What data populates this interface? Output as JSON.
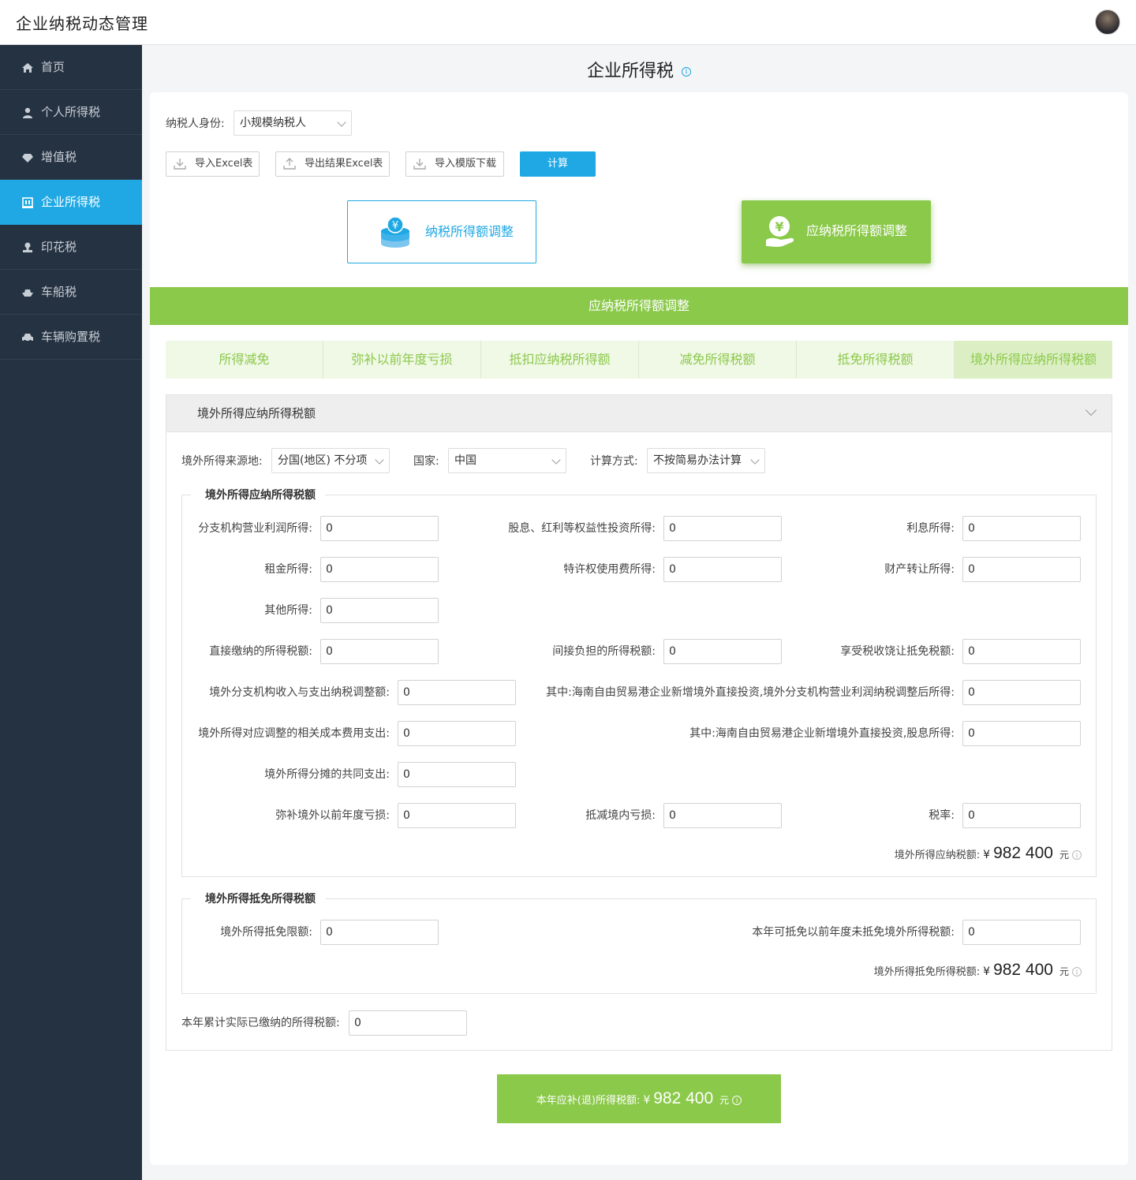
{
  "app": {
    "title": "企业纳税动态管理"
  },
  "sidebar": {
    "items": [
      {
        "label": "首页",
        "icon": "home-icon"
      },
      {
        "label": "个人所得税",
        "icon": "user-icon"
      },
      {
        "label": "增值税",
        "icon": "diamond-icon"
      },
      {
        "label": "企业所得税",
        "icon": "building-icon"
      },
      {
        "label": "印花税",
        "icon": "stamp-icon"
      },
      {
        "label": "车船税",
        "icon": "boat-icon"
      },
      {
        "label": "车辆购置税",
        "icon": "car-icon"
      }
    ],
    "active": "企业所得税"
  },
  "page": {
    "title": "企业所得税",
    "info_icon": "i"
  },
  "taxpayer": {
    "label": "纳税人身份:",
    "value": "小规模纳税人"
  },
  "toolbar": {
    "import_excel": "导入Excel表",
    "export_excel": "导出结果Excel表",
    "template_download": "导入模版下载",
    "calculate": "计算"
  },
  "modes": {
    "taxable_income_adjust": "纳税所得额调整",
    "payable_income_adjust": "应纳税所得额调整"
  },
  "section_bar": "应纳税所得额调整",
  "tabs": [
    "所得减免",
    "弥补以前年度亏损",
    "抵扣应纳税所得额",
    "减免所得税额",
    "抵免所得税额",
    "境外所得应纳所得税额"
  ],
  "panel": {
    "title": "境外所得应纳所得税额",
    "source_label": "境外所得来源地:",
    "source_value": "分国(地区) 不分项",
    "country_label": "国家:",
    "country_value": "中国",
    "method_label": "计算方式:",
    "method_value": "不按简易办法计算"
  },
  "group1": {
    "legend": "境外所得应纳所得税额",
    "fields": [
      {
        "label": "分支机构营业利润所得:",
        "value": "0"
      },
      {
        "label": "股息、红利等权益性投资所得:",
        "value": "0"
      },
      {
        "label": "利息所得:",
        "value": "0"
      },
      {
        "label": "租金所得:",
        "value": "0"
      },
      {
        "label": "特许权使用费所得:",
        "value": "0"
      },
      {
        "label": "财产转让所得:",
        "value": "0"
      },
      {
        "label": "其他所得:",
        "value": "0"
      },
      {
        "label": "直接缴纳的所得税额:",
        "value": "0"
      },
      {
        "label": "间接负担的所得税额:",
        "value": "0"
      },
      {
        "label": "享受税收饶让抵免税额:",
        "value": "0"
      },
      {
        "label": "境外分支机构收入与支出纳税调整额:",
        "value": "0"
      },
      {
        "label": "其中:海南自由贸易港企业新增境外直接投资,境外分支机构营业利润纳税调整后所得:",
        "value": "0"
      },
      {
        "label": "境外所得对应调整的相关成本费用支出:",
        "value": "0"
      },
      {
        "label": "其中:海南自由贸易港企业新增境外直接投资,股息所得:",
        "value": "0"
      },
      {
        "label": "境外所得分摊的共同支出:",
        "value": "0"
      },
      {
        "label": "弥补境外以前年度亏损:",
        "value": "0"
      },
      {
        "label": "抵减境内亏损:",
        "value": "0"
      },
      {
        "label": "税率:",
        "value": "0"
      }
    ],
    "total": {
      "label": "境外所得应纳税额:",
      "currency": "¥",
      "amount": "982 400",
      "unit": "元"
    }
  },
  "group2": {
    "legend": "境外所得抵免所得税额",
    "fields": [
      {
        "label": "境外所得抵免限额:",
        "value": "0"
      },
      {
        "label": "本年可抵免以前年度未抵免境外所得税额:",
        "value": "0"
      }
    ],
    "total": {
      "label": "境外所得抵免所得税额:",
      "currency": "¥",
      "amount": "982 400",
      "unit": "元"
    }
  },
  "paid": {
    "label": "本年累计实际已缴纳的所得税额:",
    "value": "0"
  },
  "bottom": {
    "label": "本年应补(退)所得税额:",
    "currency": "¥",
    "amount": "982 400",
    "unit": "元"
  },
  "colors": {
    "primary": "#1fa8e4",
    "green": "#8bc94a",
    "sidebar": "#253241"
  }
}
